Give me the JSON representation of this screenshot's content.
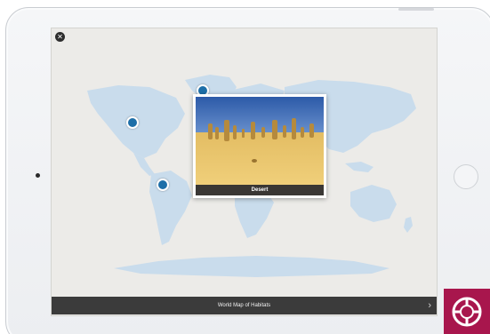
{
  "screen": {
    "close_glyph": "✕",
    "card": {
      "caption": "Desert"
    },
    "bottom_bar": {
      "title": "World Map of Habitats",
      "chevron_glyph": "›"
    },
    "pins": [
      {
        "name": "pin-arctic"
      },
      {
        "name": "pin-north-america"
      },
      {
        "name": "pin-south-america"
      }
    ]
  },
  "colors": {
    "map_land": "#c9dcec",
    "pin": "#1e6fa8",
    "screen_bg": "#ecebe8",
    "bar": "#3b3b3b",
    "badge": "#a8164d"
  },
  "icons": {
    "badge": "life-ring-icon",
    "close": "close-icon",
    "chevron": "chevron-right-icon"
  }
}
